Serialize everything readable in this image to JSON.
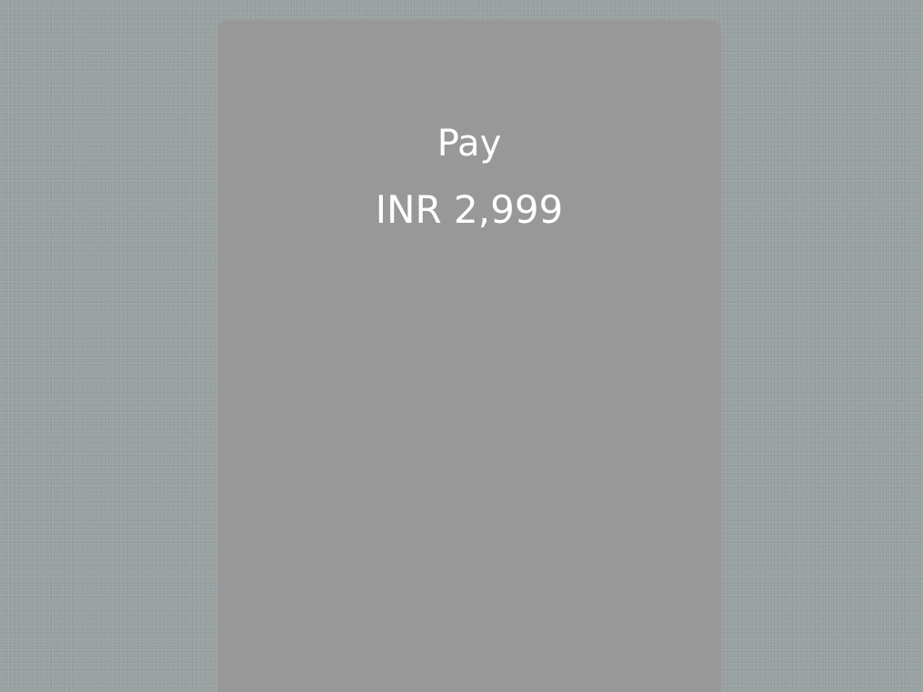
{
  "payment_sheet": {
    "title": "Pay",
    "amount": "INR 2,999"
  },
  "colors": {
    "backdrop": "#9a9b9b",
    "panel": "#989898",
    "text": "#ffffff"
  }
}
